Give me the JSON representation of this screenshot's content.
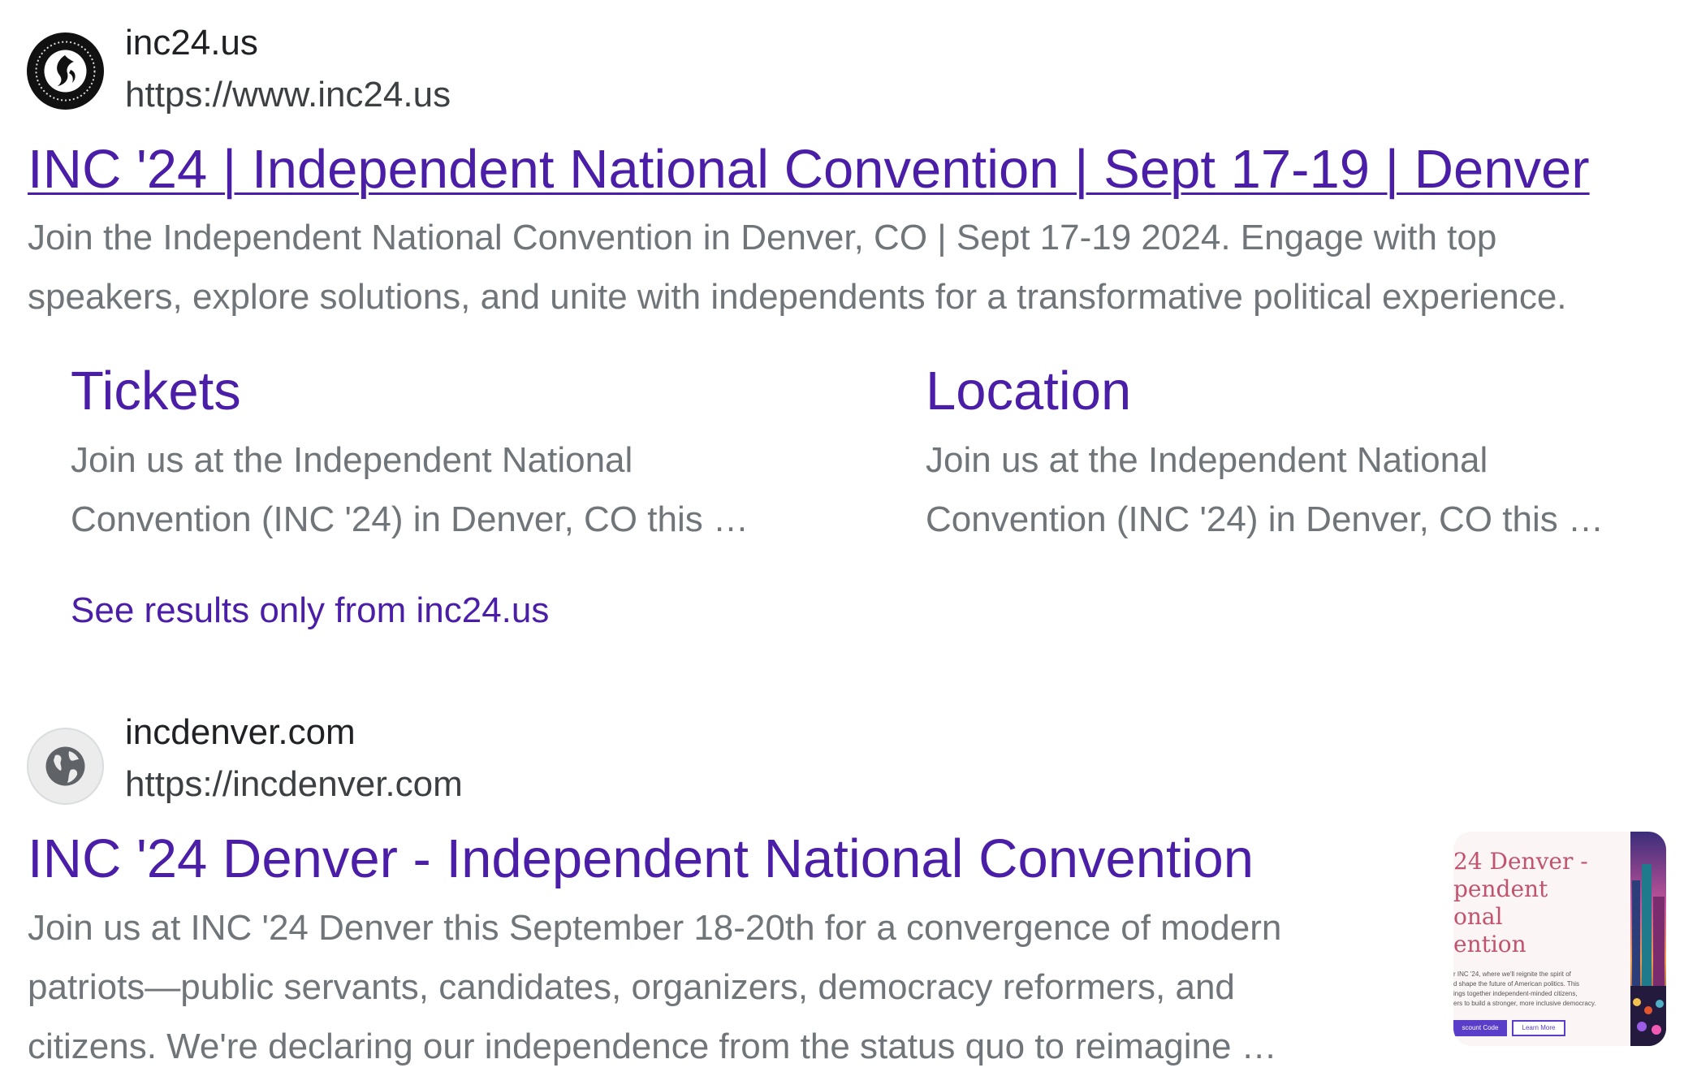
{
  "results": [
    {
      "site_name": "inc24.us",
      "url": "https://www.inc24.us",
      "favicon": "inc24-logo-icon",
      "title": "INC '24 | Independent National Convention | Sept 17-19 | Denver",
      "snippet_lines": [
        "Join the Independent National Convention in Denver, CO | Sept 17-19 2024. Engage with top",
        "speakers, explore solutions, and unite with independents for a transformative political experience."
      ],
      "sitelinks": [
        {
          "title": "Tickets",
          "lines": [
            "Join us at the Independent National",
            "Convention (INC '24) in Denver, CO this …"
          ]
        },
        {
          "title": "Location",
          "lines": [
            "Join us at the Independent National",
            "Convention (INC '24) in Denver, CO this …"
          ]
        }
      ],
      "more_results_link": "See results only from inc24.us"
    },
    {
      "site_name": "incdenver.com",
      "url": "https://incdenver.com",
      "favicon": "globe-icon",
      "title": "INC '24 Denver - Independent National Convention",
      "snippet_lines": [
        "Join us at INC '24 Denver this September 18-20th for a convergence of modern",
        "patriots—public servants, candidates, organizers, democracy reformers, and",
        "citizens. We're declaring our independence from the status quo to reimagine …"
      ],
      "thumbnail": {
        "title_lines": [
          "24 Denver -",
          "pendent",
          "onal",
          "ention"
        ],
        "body_lines": [
          "r INC '24, where we'll reignite the spirit of",
          "d shape the future of American politics. This",
          "ings together independent-minded citizens,",
          "ers to build a stronger, more inclusive democracy."
        ],
        "button_primary": "scount Code",
        "button_secondary": "Learn More"
      }
    }
  ],
  "colors": {
    "visited_link": "#4b1ea7",
    "snippet_text": "#70757a",
    "site_text": "#202124"
  }
}
